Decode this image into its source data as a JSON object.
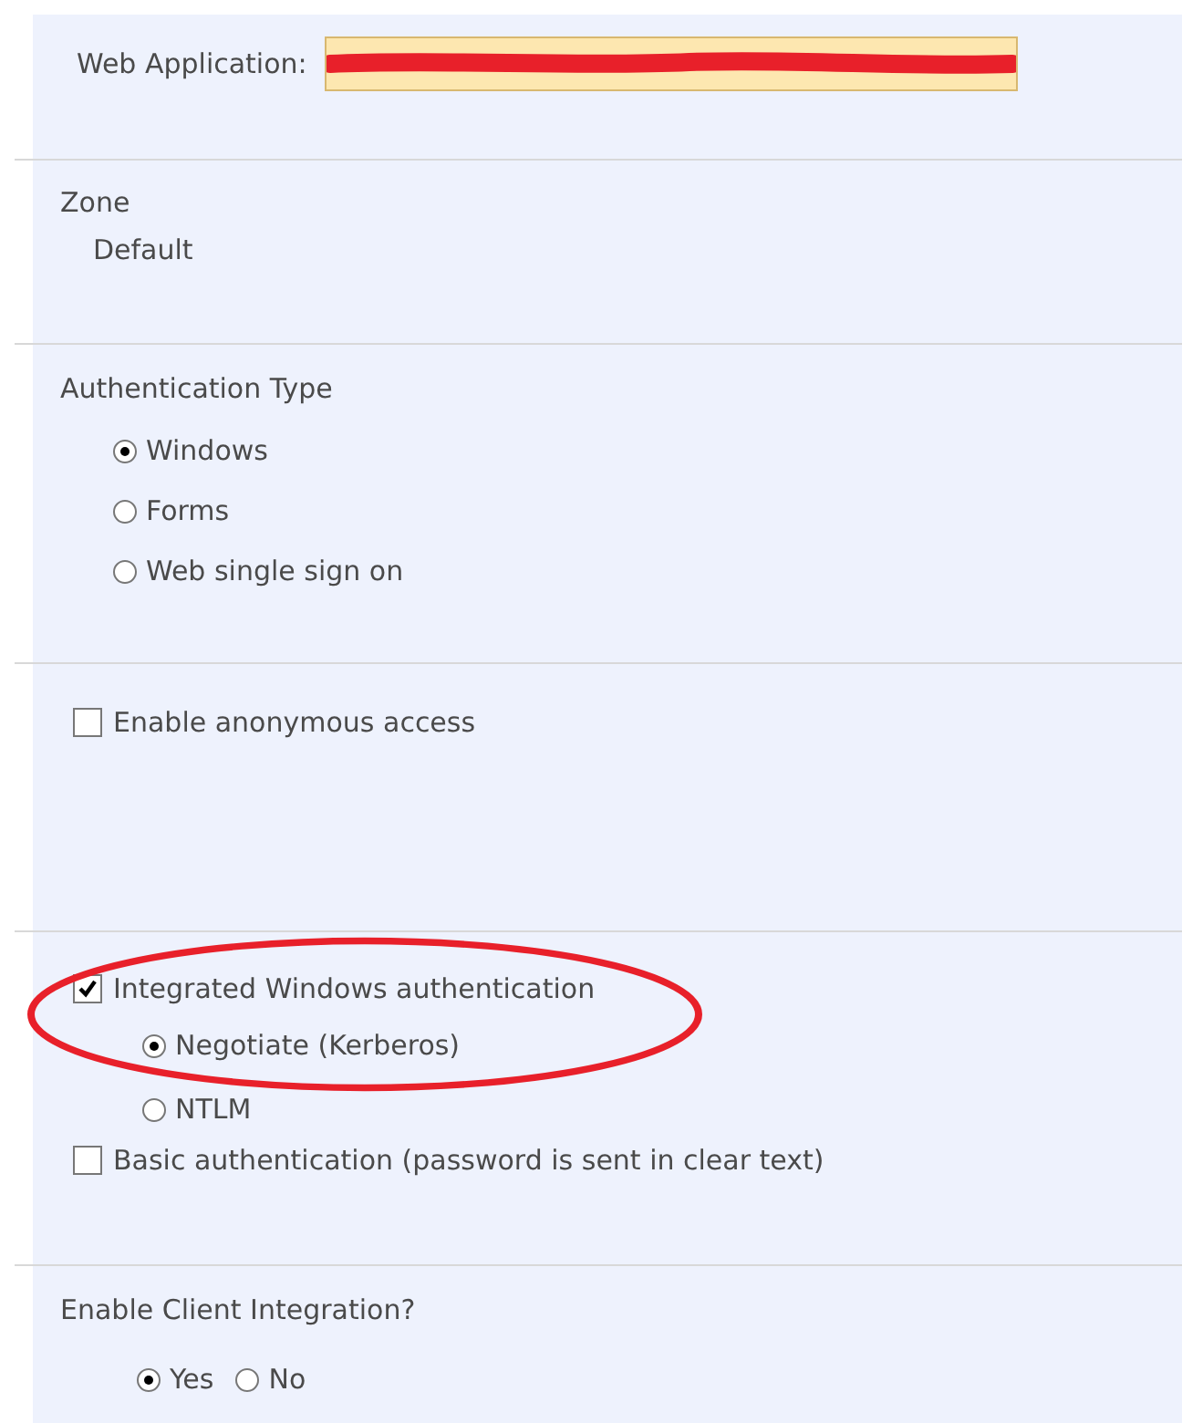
{
  "web_application": {
    "label": "Web Application:"
  },
  "zone": {
    "title": "Zone",
    "value": "Default"
  },
  "authentication_type": {
    "title": "Authentication Type",
    "options": [
      {
        "label": "Windows",
        "selected": true
      },
      {
        "label": "Forms",
        "selected": false
      },
      {
        "label": "Web single sign on",
        "selected": false
      }
    ]
  },
  "anonymous_access": {
    "label": "Enable anonymous access",
    "checked": false
  },
  "integrated_windows": {
    "label": "Integrated Windows authentication",
    "checked": true,
    "options": [
      {
        "label": "Negotiate (Kerberos)",
        "selected": true
      },
      {
        "label": "NTLM",
        "selected": false
      }
    ]
  },
  "basic_authentication": {
    "label": "Basic authentication (password is sent in clear text)",
    "checked": false
  },
  "client_integration": {
    "title": "Enable Client Integration?",
    "options": [
      {
        "label": "Yes",
        "selected": true
      },
      {
        "label": "No",
        "selected": false
      }
    ]
  }
}
